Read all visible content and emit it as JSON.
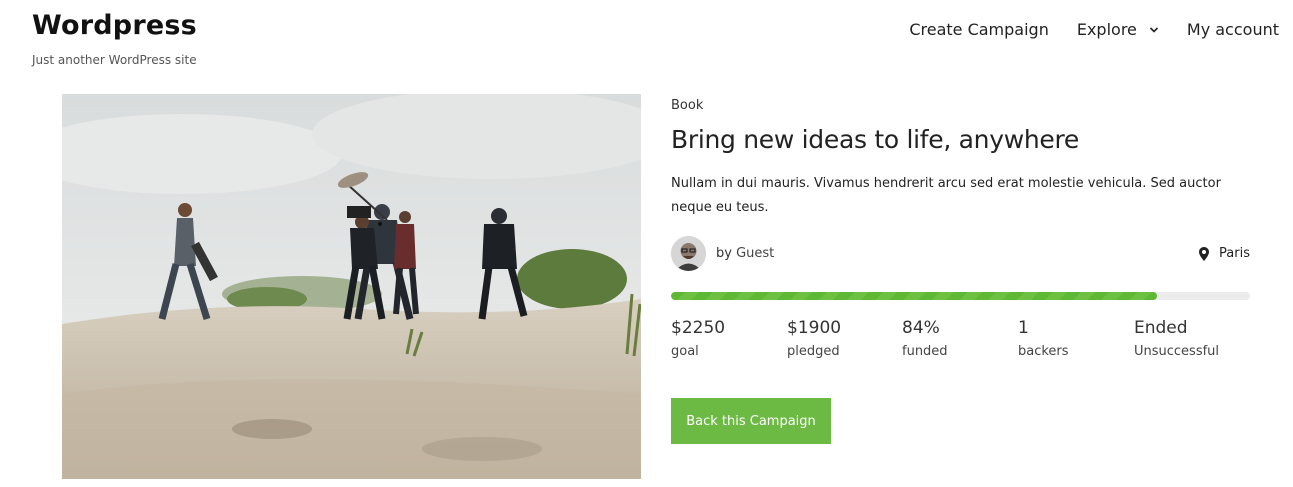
{
  "site": {
    "title": "Wordpress",
    "tagline": "Just another WordPress site"
  },
  "nav": {
    "items": [
      {
        "label": "Create Campaign"
      },
      {
        "label": "Explore",
        "has_dropdown": true
      },
      {
        "label": "My account"
      }
    ]
  },
  "campaign": {
    "category": "Book",
    "title": "Bring new ideas to life, anywhere",
    "description": "Nullam in dui mauris. Vivamus hendrerit arcu sed erat molestie vehicula. Sed auctor neque eu teus.",
    "author_prefix": "by",
    "author": "Guest",
    "location": "Paris",
    "progress_percent": 84,
    "stats": [
      {
        "value": "$2250",
        "label": "goal"
      },
      {
        "value": "$1900",
        "label": "pledged"
      },
      {
        "value": "84%",
        "label": "funded"
      },
      {
        "value": "1",
        "label": "backers"
      },
      {
        "value": "Ended",
        "label": "Unsuccessful"
      }
    ],
    "button_label": "Back this Campaign"
  },
  "colors": {
    "accent": "#6cb944",
    "progress": "#5fb833",
    "track": "#ececec"
  },
  "icons": {
    "location": "map-pin-icon",
    "dropdown": "chevron-down-icon"
  }
}
